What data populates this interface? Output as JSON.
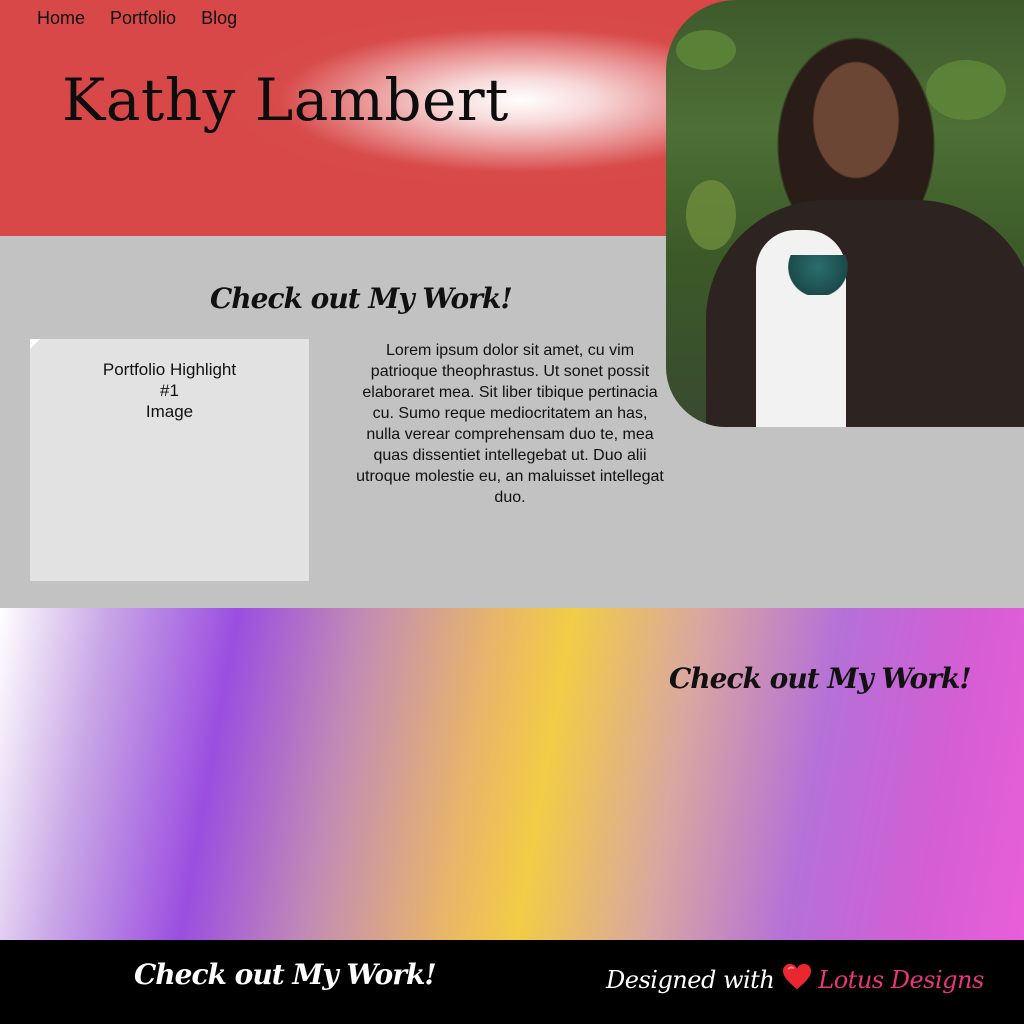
{
  "nav": {
    "items": [
      "Home",
      "Portfolio",
      "Blog"
    ]
  },
  "header": {
    "title": "Kathy Lambert"
  },
  "section1": {
    "heading": "Check out My Work!",
    "highlight_line1": "Portfolio Highlight",
    "highlight_line2": "#1",
    "highlight_line3": "Image",
    "body": "Lorem ipsum dolor sit amet, cu vim patrioque theophrastus. Ut sonet possit elaboraret mea. Sit liber tibique pertinacia cu. Sumo reque mediocritatem an has, nulla verear comprehensam duo te, mea quas dissentiet intellegebat ut. Duo alii utroque molestie eu, an maluisset intellegat duo."
  },
  "section2": {
    "heading": "Check out My Work!"
  },
  "footer": {
    "heading": "Check out My Work!",
    "credit_prefix": "Designed with",
    "credit_brand": "Lotus Designs"
  },
  "colors": {
    "header": "#d84848",
    "gray_bg": "#c2c2c2",
    "brand_pink": "#e8367a"
  },
  "icons": {
    "heart": "heart-icon"
  }
}
